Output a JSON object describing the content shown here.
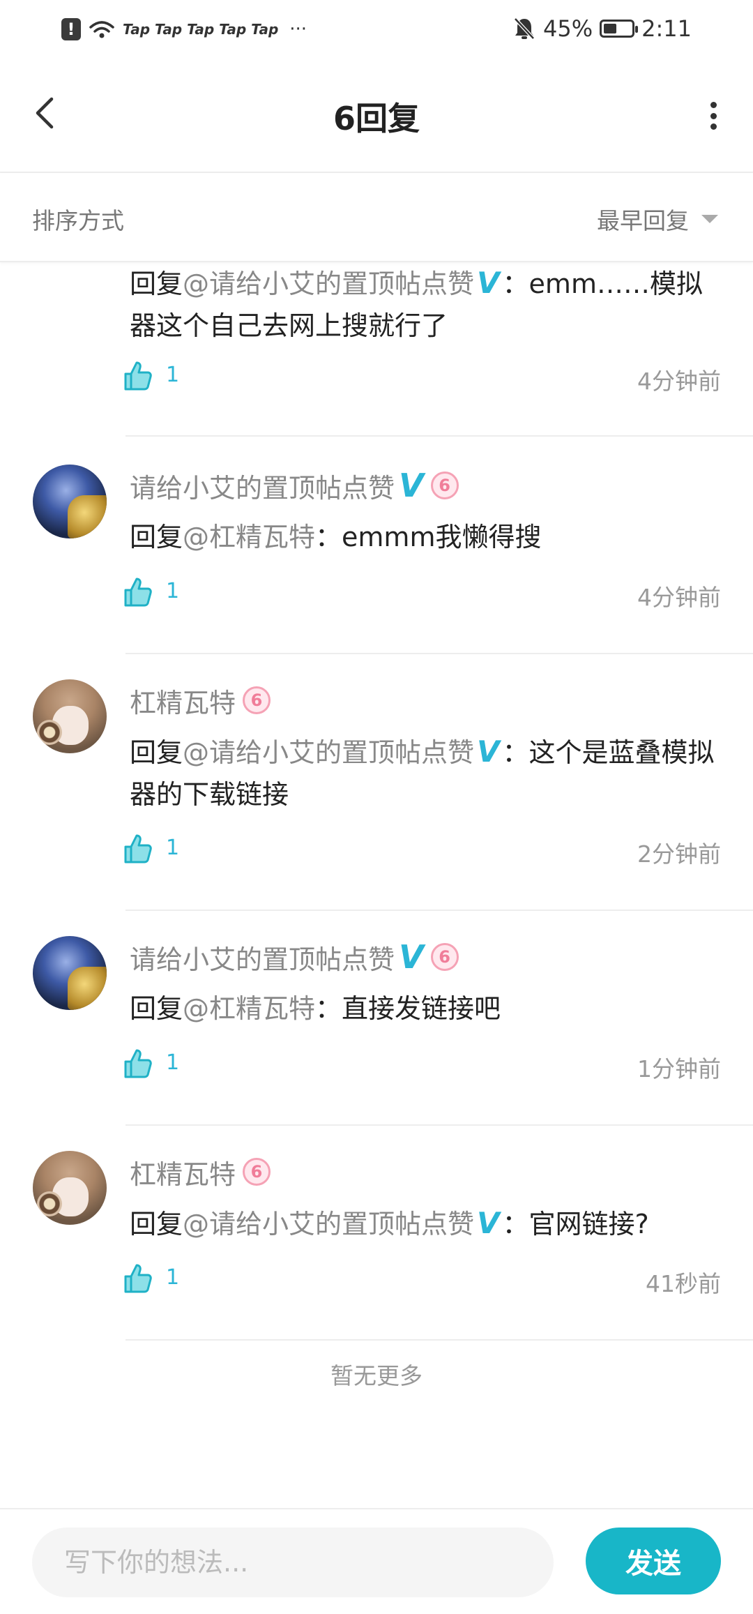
{
  "status_bar": {
    "taps": "Tap Tap Tap Tap Tap",
    "dots": "···",
    "battery": "45%",
    "time": "2:11"
  },
  "header": {
    "title": "6回复",
    "back_icon": "chevron-left-icon",
    "more_icon": "more-vertical-icon"
  },
  "sort": {
    "label": "排序方式",
    "selected": "最早回复"
  },
  "replies": [
    {
      "user": "",
      "reply_prefix": "回复",
      "mention": "@请给小艾的置顶帖点赞",
      "mention_verified": "V",
      "text": "：emm……模拟器这个自己去网上搜就行了",
      "likes": "1",
      "time": "4分钟前"
    },
    {
      "user": "请给小艾的置顶帖点赞",
      "verified": "V",
      "level": "6",
      "reply_prefix": "回复",
      "mention": "@杠精瓦特",
      "text": "：emmm我懒得搜",
      "likes": "1",
      "time": "4分钟前"
    },
    {
      "user": "杠精瓦特",
      "level": "6",
      "reply_prefix": "回复",
      "mention": "@请给小艾的置顶帖点赞",
      "mention_verified": "V",
      "text": "：这个是蓝叠模拟器的下载链接",
      "likes": "1",
      "time": "2分钟前"
    },
    {
      "user": "请给小艾的置顶帖点赞",
      "verified": "V",
      "level": "6",
      "reply_prefix": "回复",
      "mention": "@杠精瓦特",
      "text": "：直接发链接吧",
      "likes": "1",
      "time": "1分钟前"
    },
    {
      "user": "杠精瓦特",
      "level": "6",
      "reply_prefix": "回复",
      "mention": "@请给小艾的置顶帖点赞",
      "mention_verified": "V",
      "text": "：官网链接?",
      "likes": "1",
      "time": "41秒前"
    }
  ],
  "no_more": "暂无更多",
  "composer": {
    "placeholder": "写下你的想法...",
    "send": "发送"
  },
  "colors": {
    "accent": "#18b6c8",
    "verified": "#2bb5d6",
    "level_badge": "#f07d99"
  }
}
